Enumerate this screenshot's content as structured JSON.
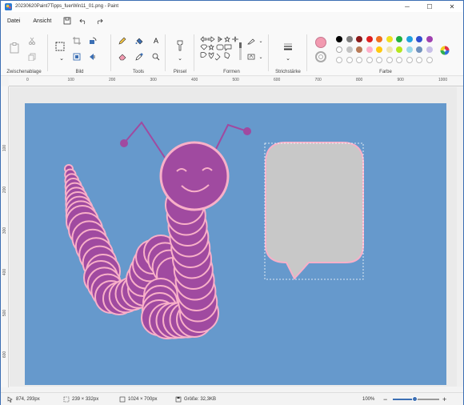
{
  "window": {
    "title": "20230620Paint7Tipps_fuerWin11_01.png - Paint"
  },
  "menu": {
    "file": "Datei",
    "view": "Ansicht"
  },
  "ribbon": {
    "clipboard_label": "Zwischenablage",
    "image_label": "Bild",
    "tools_label": "Tools",
    "brushes_label": "Pinsel",
    "shapes_label": "Formen",
    "stroke_label": "Strichstärke",
    "colors_label": "Farbe"
  },
  "colors": {
    "accent": "#3c6fb4",
    "canvas_bg": "#6699cc",
    "worm": "#a04aa0",
    "outline": "#f8b0c8",
    "bubble": "#c8c8c8",
    "row1": [
      "#000000",
      "#7f7f7f",
      "#8b1a1a",
      "#e02020",
      "#f07020",
      "#f0e020",
      "#20b040",
      "#20a0e0",
      "#3050d0",
      "#a040b0"
    ],
    "row2": [
      "#ffffff",
      "#c3c3c3",
      "#b97a57",
      "#ffaec9",
      "#ffc90e",
      "#efe4b0",
      "#b5e61d",
      "#99d9ea",
      "#7092be",
      "#c8bfe7"
    ]
  },
  "ruler": {
    "h": [
      "0",
      "100",
      "200",
      "300",
      "400",
      "500",
      "600",
      "700",
      "800",
      "900",
      "1000"
    ],
    "v": [
      "100",
      "200",
      "300",
      "400",
      "500",
      "600"
    ]
  },
  "status": {
    "cursor": "874, 293px",
    "selection": "239 × 332px",
    "canvas_size": "1024 × 700px",
    "file_size": "Größe: 32,3KB",
    "zoom": "100%"
  }
}
